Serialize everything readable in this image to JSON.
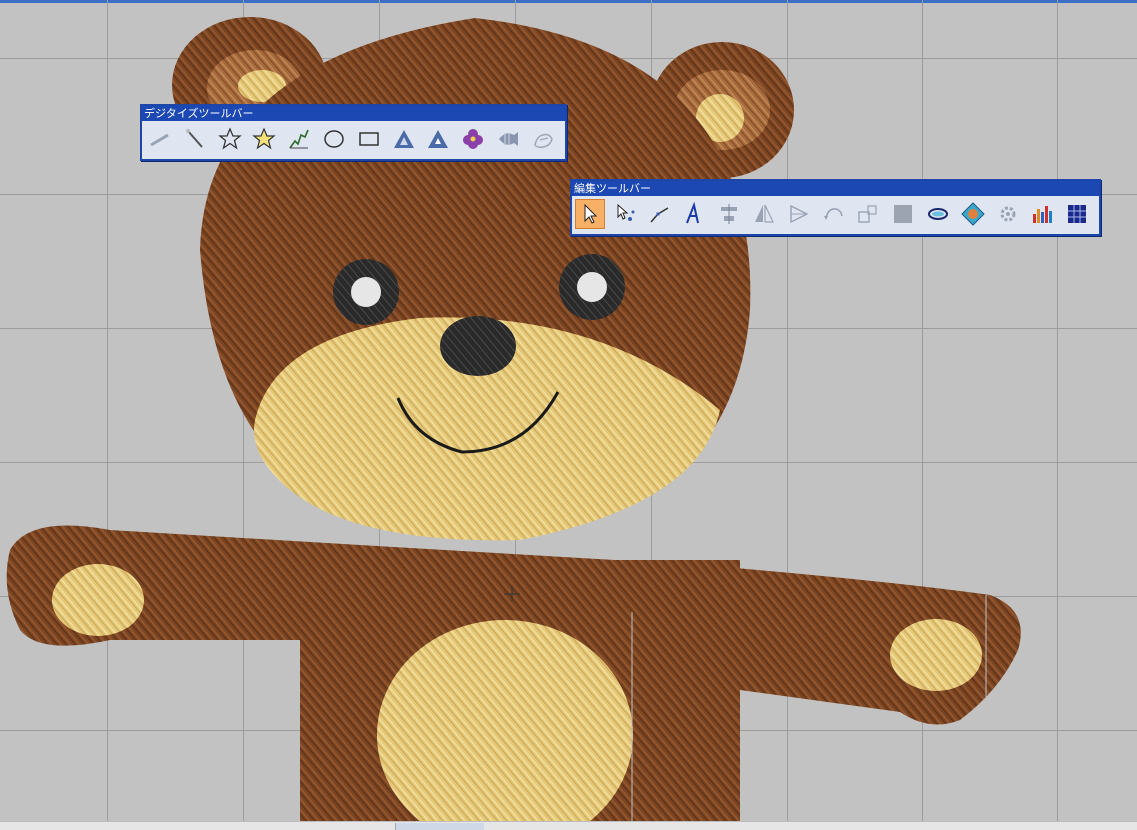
{
  "digitize_toolbar": {
    "title": "デジタイズツールバー",
    "tools": [
      {
        "icon": "hand-stitch-icon",
        "disabled": true
      },
      {
        "icon": "wand-icon",
        "disabled": false
      },
      {
        "icon": "star-outline-icon",
        "disabled": false
      },
      {
        "icon": "star-filled-icon",
        "disabled": false
      },
      {
        "icon": "stitch-path-icon",
        "disabled": false
      },
      {
        "icon": "ellipse-icon",
        "disabled": false
      },
      {
        "icon": "rectangle-icon",
        "disabled": false
      },
      {
        "icon": "fill-triangle-icon",
        "disabled": false
      },
      {
        "icon": "fill-triangle-2-icon",
        "disabled": false
      },
      {
        "icon": "flower-icon",
        "disabled": false
      },
      {
        "icon": "fish-icon",
        "disabled": false
      },
      {
        "icon": "glove-icon",
        "disabled": true
      }
    ]
  },
  "edit_toolbar": {
    "title": "編集ツールバー",
    "tools": [
      {
        "icon": "select-arrow-icon",
        "active": true
      },
      {
        "icon": "point-edit-icon",
        "disabled": false
      },
      {
        "icon": "reshape-icon",
        "disabled": false
      },
      {
        "icon": "text-a-icon",
        "disabled": false
      },
      {
        "icon": "align-icon",
        "disabled": true
      },
      {
        "icon": "mirror-icon",
        "disabled": true
      },
      {
        "icon": "flip-icon",
        "disabled": true
      },
      {
        "icon": "rotate-icon",
        "disabled": true
      },
      {
        "icon": "resize-icon",
        "disabled": true
      },
      {
        "icon": "gray-square-icon",
        "disabled": true
      },
      {
        "icon": "outline-oval-icon",
        "disabled": false
      },
      {
        "icon": "monogram-diamond-icon",
        "disabled": false
      },
      {
        "icon": "gear-effect-icon",
        "disabled": true
      },
      {
        "icon": "color-bars-icon",
        "disabled": false
      },
      {
        "icon": "grid-icon",
        "disabled": false
      }
    ]
  },
  "colors": {
    "canvas_bg": "#c2c2c2",
    "grid": "#9c9c9c",
    "fur_brown": "#7a4523",
    "fur_dark": "#5a2e14",
    "muzzle_yellow": "#e8cf80",
    "ear_light": "#c98a55",
    "eye_black": "#222222",
    "toolbar_title": "#1c48b4"
  }
}
